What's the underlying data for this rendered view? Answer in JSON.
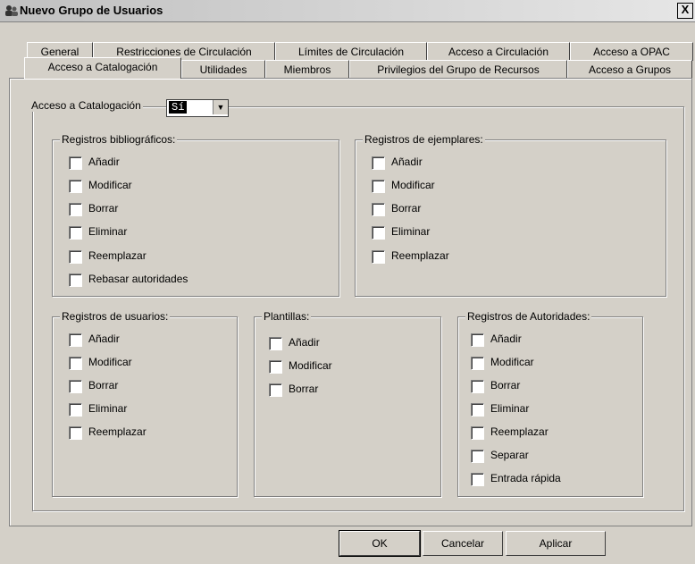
{
  "window": {
    "title": "Nuevo Grupo de Usuarios",
    "close": "X"
  },
  "tabs_row1": [
    "General",
    "Restricciones de Circulación",
    "Límites de Circulación",
    "Acceso a Circulación",
    "Acceso a OPAC"
  ],
  "tabs_row2": [
    "Acceso a Catalogación",
    "Utilidades",
    "Miembros",
    "Privilegios del Grupo de Recursos",
    "Acceso a Grupos"
  ],
  "active_tab": "Acceso a Catalogación",
  "access": {
    "label": "Acceso a Catalogación",
    "value": "Sí"
  },
  "groups": {
    "bib": {
      "title": "Registros bibliográficos:",
      "items": [
        "Añadir",
        "Modificar",
        "Borrar",
        "Eliminar",
        "Reemplazar",
        "Rebasar autoridades"
      ]
    },
    "items": {
      "title": "Registros de ejemplares:",
      "items": [
        "Añadir",
        "Modificar",
        "Borrar",
        "Eliminar",
        "Reemplazar"
      ]
    },
    "users": {
      "title": "Registros de usuarios:",
      "items": [
        "Añadir",
        "Modificar",
        "Borrar",
        "Eliminar",
        "Reemplazar"
      ]
    },
    "templates": {
      "title": "Plantillas:",
      "items": [
        "Añadir",
        "Modificar",
        "Borrar"
      ]
    },
    "auth": {
      "title": "Registros de Autoridades:",
      "items": [
        "Añadir",
        "Modificar",
        "Borrar",
        "Eliminar",
        "Reemplazar",
        "Separar",
        "Entrada rápida"
      ]
    }
  },
  "buttons": {
    "ok": "OK",
    "cancel": "Cancelar",
    "apply": "Aplicar"
  }
}
